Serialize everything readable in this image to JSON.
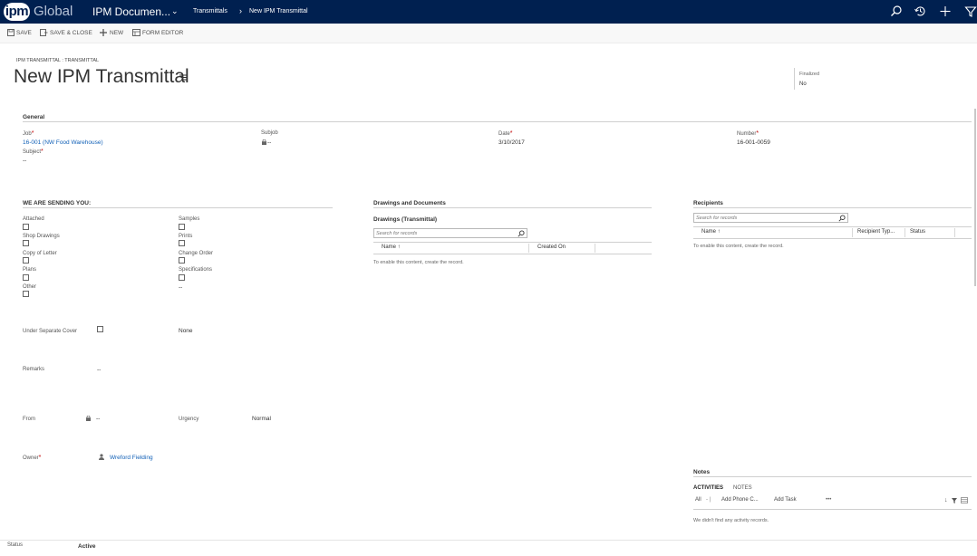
{
  "topbar": {
    "logo_mark": "ipm",
    "logo_text": "Global",
    "app_name": "IPM Documen...",
    "breadcrumb": [
      "Transmittals",
      "New IPM Transmittal"
    ],
    "icons": [
      "search-icon",
      "history-icon",
      "plus-icon",
      "filter-icon"
    ],
    "background_color": "#002050"
  },
  "commands": [
    {
      "label": "SAVE",
      "icon": "save-icon"
    },
    {
      "label": "SAVE & CLOSE",
      "icon": "save-close-icon"
    },
    {
      "label": "NEW",
      "icon": "plus-icon"
    },
    {
      "label": "FORM EDITOR",
      "icon": "form-editor-icon"
    }
  ],
  "header": {
    "entity": "IPM TRANSMITTAL : TRANSMITTAL",
    "title": "New IPM Transmittal",
    "finalized_label": "Finalized",
    "finalized_value": "No"
  },
  "general": {
    "title": "General",
    "job_label": "Job",
    "job_value": "16-001 (NW Food Warehouse)",
    "subject_label": "Subject",
    "subject_value": "--",
    "subjob_label": "Subjob",
    "subjob_value": "--",
    "date_label": "Date",
    "date_value": "3/10/2017",
    "number_label": "Number",
    "number_value": "16-001-0059"
  },
  "sending": {
    "title": "WE ARE SENDING YOU:",
    "left_items": [
      "Attached",
      "Shop Drawings",
      "Copy of Letter",
      "Plans",
      "Other"
    ],
    "right_items": [
      "Samples",
      "Prints",
      "Change Order",
      "Specifications"
    ],
    "right_extra_value": "--",
    "under_separate_cover_label": "Under Separate Cover",
    "under_separate_cover_value": "None",
    "remarks_label": "Remarks",
    "remarks_value": "--",
    "from_label": "From",
    "from_value": "--",
    "urgency_label": "Urgency",
    "urgency_value": "Normal",
    "owner_label": "Owner",
    "owner_value": "Wreford Fielding"
  },
  "drawings": {
    "title": "Drawings and Documents",
    "subgrid_title": "Drawings (Transmittal)",
    "search_placeholder": "Search for records",
    "columns": [
      "Name ↑",
      "Created On"
    ],
    "empty_text": "To enable this content, create the record."
  },
  "recipients": {
    "title": "Recipients",
    "search_placeholder": "Search for records",
    "columns": [
      "Name ↑",
      "Recipient Typ...",
      "Status"
    ],
    "empty_text": "To enable this content, create the record."
  },
  "notes": {
    "title": "Notes",
    "tabs": [
      "ACTIVITIES",
      "NOTES"
    ],
    "filter_all": "All",
    "filter_separator": "- |",
    "actions": [
      "Add Phone C...",
      "Add Task",
      "•••"
    ],
    "empty_text": "We didn't find any activity records."
  },
  "footer": {
    "status_label": "Status",
    "status_value": "Active"
  }
}
